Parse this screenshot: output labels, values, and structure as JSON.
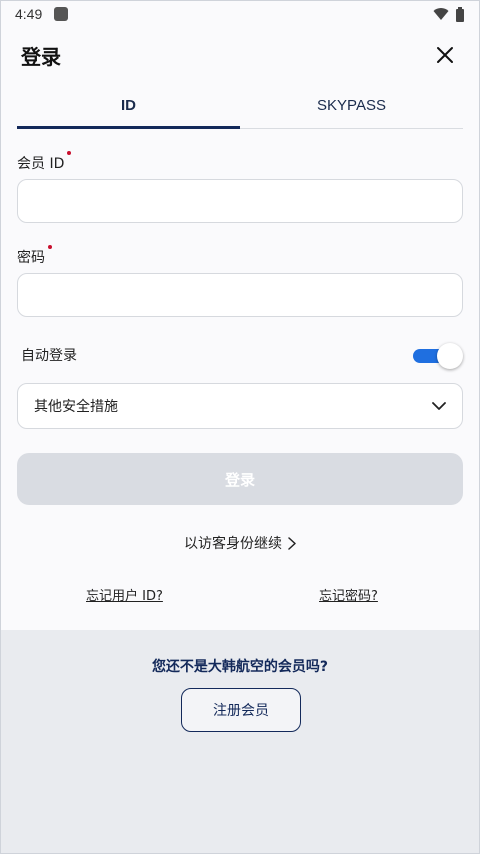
{
  "status_bar": {
    "time": "4:49"
  },
  "header": {
    "title": "登录"
  },
  "tabs": [
    {
      "label": "ID",
      "active": true
    },
    {
      "label": "SKYPASS",
      "active": false
    }
  ],
  "form": {
    "member_id_label": "会员 ID",
    "member_id_value": "",
    "password_label": "密码",
    "password_value": "",
    "auto_login_label": "自动登录",
    "auto_login_on": true,
    "security_select_value": "其他安全措施",
    "login_button_label": "登录"
  },
  "links": {
    "guest_continue": "以访客身份继续",
    "forgot_user_id": "忘记用户 ID?",
    "forgot_password": "忘记密码?"
  },
  "signup": {
    "question": "您还不是大韩航空的会员吗?",
    "button_label": "注册会员"
  },
  "colors": {
    "brand_navy": "#13295a",
    "toggle_on": "#1f6fe0",
    "required_dot": "#c8102e",
    "disabled_button": "#d9dce2"
  }
}
